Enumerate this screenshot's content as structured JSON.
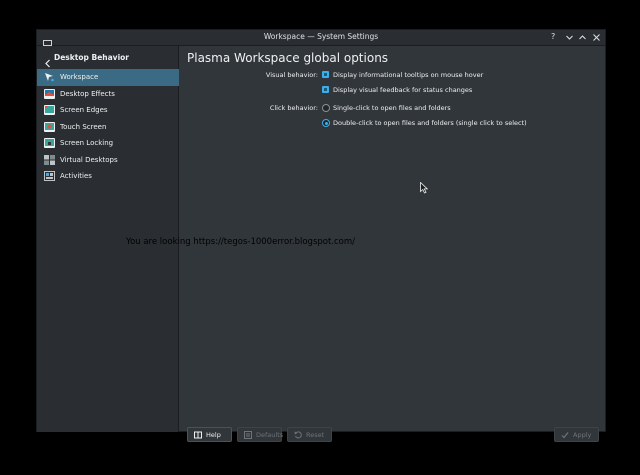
{
  "window": {
    "title": "Workspace — System Settings"
  },
  "titlebar": {
    "buttons": [
      "help-icon",
      "minimize-icon",
      "maximize-icon",
      "close-icon"
    ],
    "help_label": "?"
  },
  "sidebar": {
    "heading": "Desktop Behavior",
    "items": [
      {
        "label": "Workspace",
        "icon": "workspace-icon",
        "active": true,
        "color": "#2f3b45"
      },
      {
        "label": "Desktop Effects",
        "icon": "desktop-effects-icon",
        "active": false,
        "color": "#1e7aa8"
      },
      {
        "label": "Screen Edges",
        "icon": "screen-edges-icon",
        "active": false,
        "color": "#3aa69b"
      },
      {
        "label": "Touch Screen",
        "icon": "touch-screen-icon",
        "active": false,
        "color": "#3aa69b"
      },
      {
        "label": "Screen Locking",
        "icon": "screen-locking-icon",
        "active": false,
        "color": "#3aa69b"
      },
      {
        "label": "Virtual Desktops",
        "icon": "virtual-desktops-icon",
        "active": false,
        "color": "#bdc3c7"
      },
      {
        "label": "Activities",
        "icon": "activities-icon",
        "active": false,
        "color": "#bdc3c7"
      }
    ]
  },
  "main": {
    "title": "Plasma Workspace global options",
    "visual_behavior": {
      "label": "Visual behavior:",
      "options": [
        {
          "label": "Display informational tooltips on mouse hover",
          "checked": true
        },
        {
          "label": "Display visual feedback for status changes",
          "checked": true
        }
      ]
    },
    "click_behavior": {
      "label": "Click behavior:",
      "options": [
        {
          "label": "Single-click to open files and folders",
          "selected": false
        },
        {
          "label": "Double-click to open files and folders (single click to select)",
          "selected": true
        }
      ]
    }
  },
  "watermark": "You are looking https://tegos-1000error.blogspot.com/",
  "footer": {
    "help": "Help",
    "defaults": "Defaults",
    "reset": "Reset",
    "apply": "Apply"
  },
  "colors": {
    "accent": "#3daee9",
    "selection": "#3a6a84",
    "window_bg": "#31363b",
    "sidebar_bg": "#2a2e32"
  }
}
